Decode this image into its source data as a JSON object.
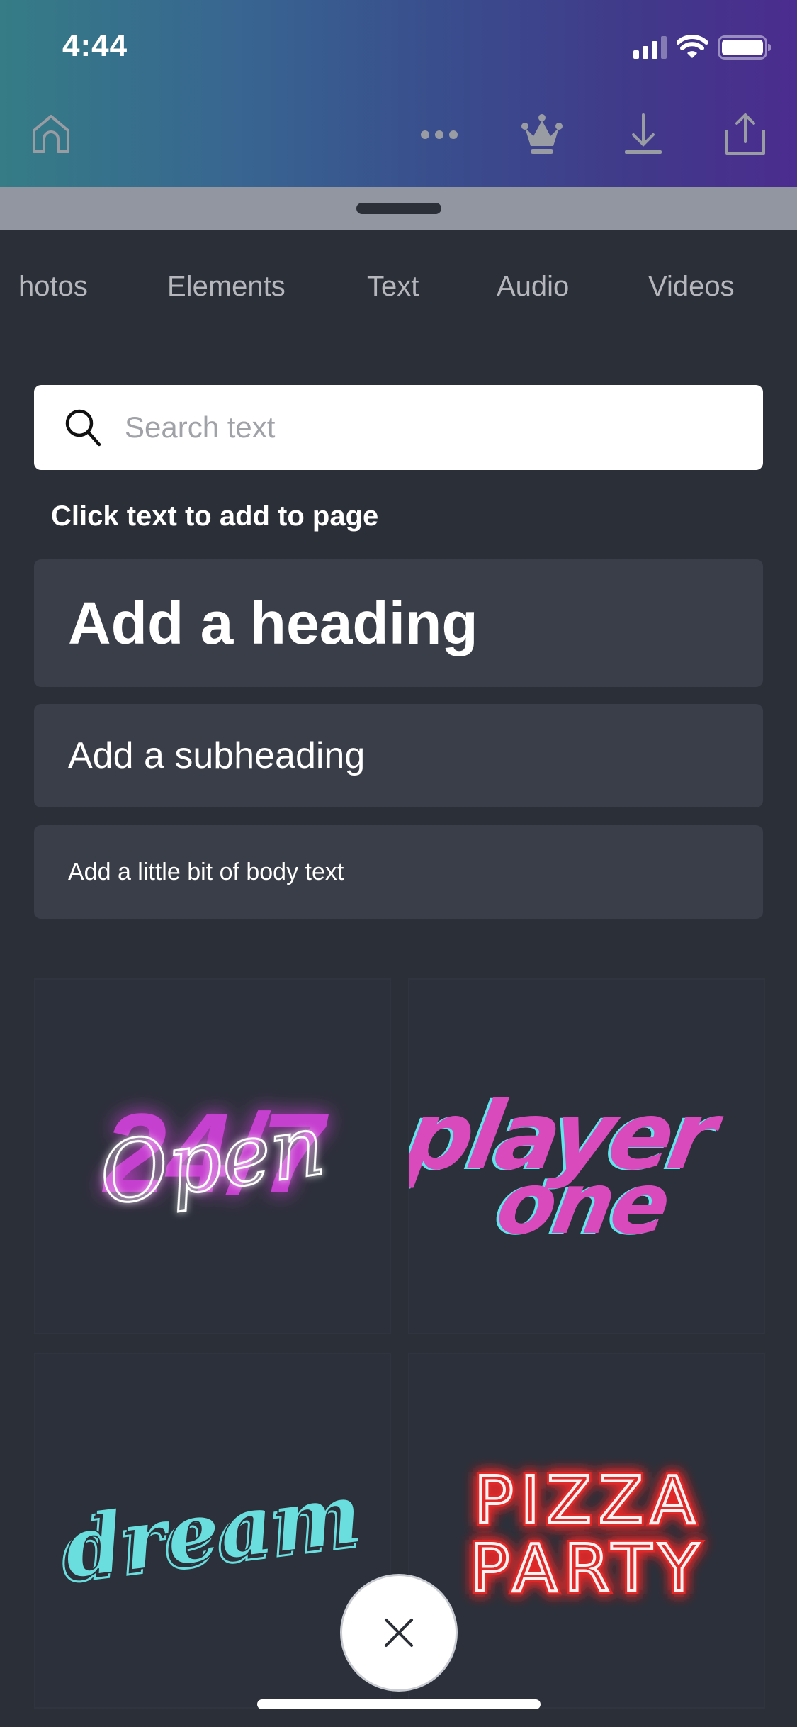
{
  "status_bar": {
    "time": "4:44",
    "signal_bars_active": 3,
    "signal_bars_total": 4,
    "wifi": "wifi-icon",
    "battery_level": 1.0
  },
  "toolbar": {
    "home_icon": "home-icon",
    "more_icon": "more-horizontal-icon",
    "premium_icon": "crown-icon",
    "download_icon": "download-icon",
    "share_icon": "share-icon",
    "gradient_colors": [
      "#357c86",
      "#386591",
      "#41398a",
      "#4b2c8f"
    ]
  },
  "tabs": [
    {
      "label": "hotos",
      "full_label": "Photos"
    },
    {
      "label": "Elements"
    },
    {
      "label": "Text",
      "active": true
    },
    {
      "label": "Audio"
    },
    {
      "label": "Videos"
    }
  ],
  "search": {
    "placeholder": "Search text",
    "value": ""
  },
  "hint": "Click text to add to page",
  "text_styles": {
    "heading": "Add a heading",
    "subheading": "Add a subheading",
    "body": "Add a little bit of body text"
  },
  "templates": [
    {
      "name": "open-24-7",
      "back_text": "24/7",
      "front_text": "Open",
      "colors": {
        "primary": "#c63fcf",
        "glow": "#ffffff"
      }
    },
    {
      "name": "player-one",
      "lines": [
        "player",
        "one"
      ],
      "colors": {
        "primary": "#d94bbd",
        "shadow": "#5fe6ec"
      }
    },
    {
      "name": "dream",
      "text": "dream",
      "colors": {
        "primary": "#6adede",
        "outline": "#2b2f38"
      }
    },
    {
      "name": "pizza-party",
      "lines": [
        "PIZZA",
        "PARTY"
      ],
      "colors": {
        "primary": "#fff2f2",
        "glow": "#e02a2a"
      }
    }
  ],
  "close_button": {
    "icon": "close-icon"
  },
  "colors": {
    "background": "#2b2f38",
    "card": "#3a3e48",
    "tab_text": "#b5b7bd"
  }
}
